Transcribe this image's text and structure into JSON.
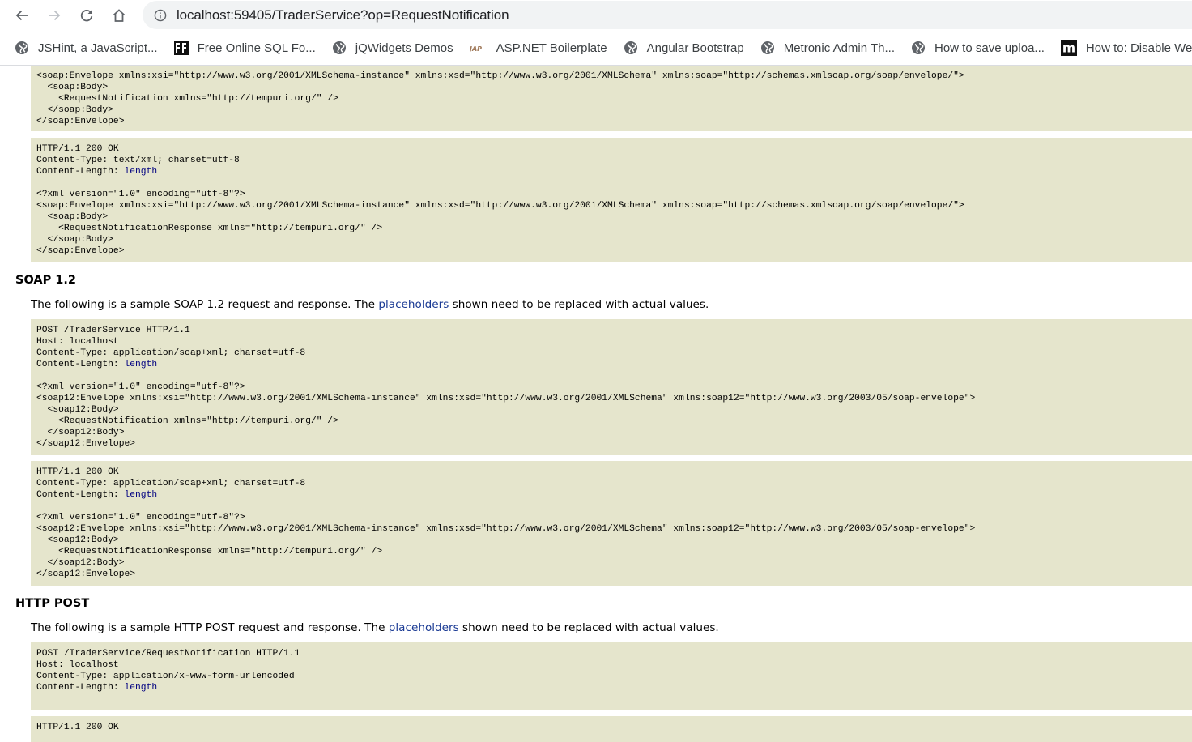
{
  "browser": {
    "url": "localhost:59405/TraderService?op=RequestNotification",
    "nav": {
      "back": "back-arrow",
      "forward": "forward-arrow",
      "reload": "reload",
      "home": "home"
    },
    "bookmarks": [
      {
        "label": "JSHint, a JavaScript...",
        "icon": "globe-icon"
      },
      {
        "label": "Free Online SQL Fo...",
        "icon": "ff-logo-icon"
      },
      {
        "label": "jQWidgets Demos",
        "icon": "globe-icon"
      },
      {
        "label": "ASP.NET Boilerplate",
        "icon": "abp-logo-icon"
      },
      {
        "label": "Angular Bootstrap",
        "icon": "globe-icon"
      },
      {
        "label": "Metronic Admin Th...",
        "icon": "globe-icon"
      },
      {
        "label": "How to save uploa...",
        "icon": "globe-icon"
      },
      {
        "label": "How to: Disable We...",
        "icon": "m-logo-icon"
      }
    ]
  },
  "colors": {
    "code_bg": "#e5e5cc",
    "placeholder_text": "#000080",
    "link": "#1a3a94"
  },
  "soap11": {
    "request_tail": [
      "<soap:Envelope xmlns:xsi=\"http://www.w3.org/2001/XMLSchema-instance\" xmlns:xsd=\"http://www.w3.org/2001/XMLSchema\" xmlns:soap=\"http://schemas.xmlsoap.org/soap/envelope/\">",
      "  <soap:Body>",
      "    <RequestNotification xmlns=\"http://tempuri.org/\" />",
      "  </soap:Body>",
      "</soap:Envelope>"
    ],
    "response": {
      "status": "HTTP/1.1 200 OK",
      "content_type": "Content-Type: text/xml; charset=utf-8",
      "content_length_label": "Content-Length: ",
      "content_length_placeholder": "length",
      "body": [
        "<?xml version=\"1.0\" encoding=\"utf-8\"?>",
        "<soap:Envelope xmlns:xsi=\"http://www.w3.org/2001/XMLSchema-instance\" xmlns:xsd=\"http://www.w3.org/2001/XMLSchema\" xmlns:soap=\"http://schemas.xmlsoap.org/soap/envelope/\">",
        "  <soap:Body>",
        "    <RequestNotificationResponse xmlns=\"http://tempuri.org/\" />",
        "  </soap:Body>",
        "</soap:Envelope>"
      ]
    }
  },
  "soap12": {
    "heading": "SOAP 1.2",
    "intro_before": "The following is a sample SOAP 1.2 request and response. The ",
    "intro_link": "placeholders",
    "intro_after": " shown need to be replaced with actual values.",
    "request": {
      "request_line": "POST /TraderService HTTP/1.1",
      "host": "Host: localhost",
      "content_type": "Content-Type: application/soap+xml; charset=utf-8",
      "content_length_label": "Content-Length: ",
      "content_length_placeholder": "length",
      "body": [
        "<?xml version=\"1.0\" encoding=\"utf-8\"?>",
        "<soap12:Envelope xmlns:xsi=\"http://www.w3.org/2001/XMLSchema-instance\" xmlns:xsd=\"http://www.w3.org/2001/XMLSchema\" xmlns:soap12=\"http://www.w3.org/2003/05/soap-envelope\">",
        "  <soap12:Body>",
        "    <RequestNotification xmlns=\"http://tempuri.org/\" />",
        "  </soap12:Body>",
        "</soap12:Envelope>"
      ]
    },
    "response": {
      "status": "HTTP/1.1 200 OK",
      "content_type": "Content-Type: application/soap+xml; charset=utf-8",
      "content_length_label": "Content-Length: ",
      "content_length_placeholder": "length",
      "body": [
        "<?xml version=\"1.0\" encoding=\"utf-8\"?>",
        "<soap12:Envelope xmlns:xsi=\"http://www.w3.org/2001/XMLSchema-instance\" xmlns:xsd=\"http://www.w3.org/2001/XMLSchema\" xmlns:soap12=\"http://www.w3.org/2003/05/soap-envelope\">",
        "  <soap12:Body>",
        "    <RequestNotificationResponse xmlns=\"http://tempuri.org/\" />",
        "  </soap12:Body>",
        "</soap12:Envelope>"
      ]
    }
  },
  "http_post": {
    "heading": "HTTP POST",
    "intro_before": "The following is a sample HTTP POST request and response. The ",
    "intro_link": "placeholders",
    "intro_after": " shown need to be replaced with actual values.",
    "request": {
      "request_line": "POST /TraderService/RequestNotification HTTP/1.1",
      "host": "Host: localhost",
      "content_type": "Content-Type: application/x-www-form-urlencoded",
      "content_length_label": "Content-Length: ",
      "content_length_placeholder": "length"
    },
    "response": {
      "status": "HTTP/1.1 200 OK"
    }
  }
}
